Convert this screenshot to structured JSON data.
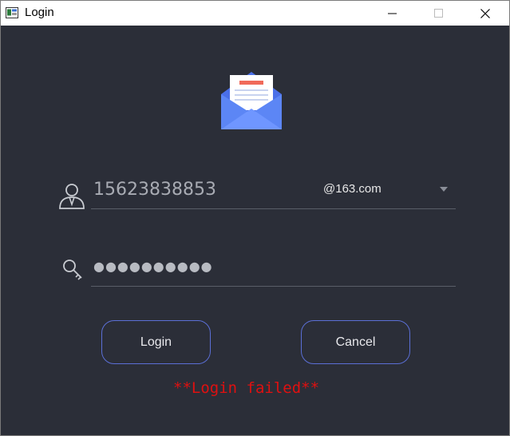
{
  "window": {
    "title": "Login",
    "minimize_icon": "minimize-icon",
    "maximize_icon": "maximize-icon",
    "close_icon": "close-icon"
  },
  "header": {
    "logo_icon": "envelope-letter-icon"
  },
  "account": {
    "icon": "user-icon",
    "value": "15623838853",
    "domain_selected": "@163.com",
    "dropdown_icon": "chevron-down-icon"
  },
  "password": {
    "icon": "key-icon",
    "masked_value": "●●●●●●●●●●"
  },
  "buttons": {
    "login": "Login",
    "cancel": "Cancel"
  },
  "status": {
    "message": "**Login failed**",
    "color": "#e01010"
  },
  "colors": {
    "background": "#2b2e38",
    "accent": "#5b6fd6",
    "envelope_blue": "#4f7cf0"
  }
}
